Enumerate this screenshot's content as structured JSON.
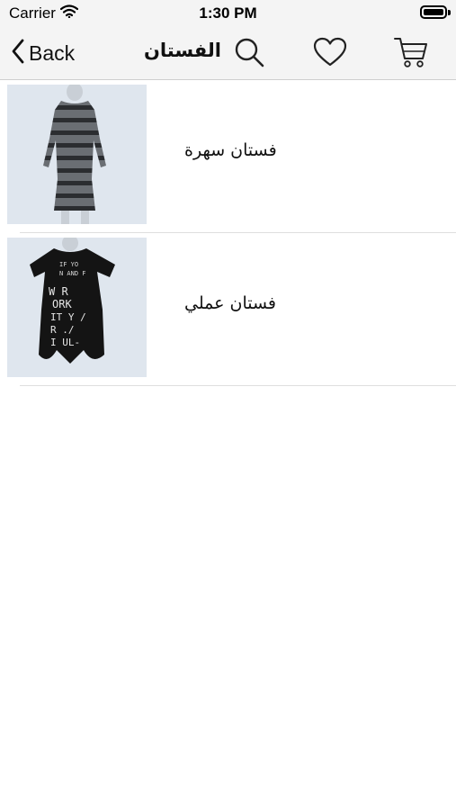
{
  "status_bar": {
    "carrier": "Carrier",
    "time": "1:30 PM",
    "wifi_icon": "wifi-icon",
    "battery_icon": "battery-icon",
    "battery_level": 1.0
  },
  "nav_bar": {
    "back_label": "Back",
    "back_icon": "chevron-left-icon",
    "title": "الفستان",
    "search_icon": "search-icon",
    "favorites_icon": "heart-icon",
    "cart_icon": "cart-icon"
  },
  "products": [
    {
      "name": "فستان سهرة",
      "image": "striped-long-sleeve-dress"
    },
    {
      "name": "فستان عملي",
      "image": "black-graphic-tshirt-dress"
    }
  ],
  "colors": {
    "bar_background": "#f4f4f4",
    "separator": "#dedede",
    "text": "#111111"
  }
}
